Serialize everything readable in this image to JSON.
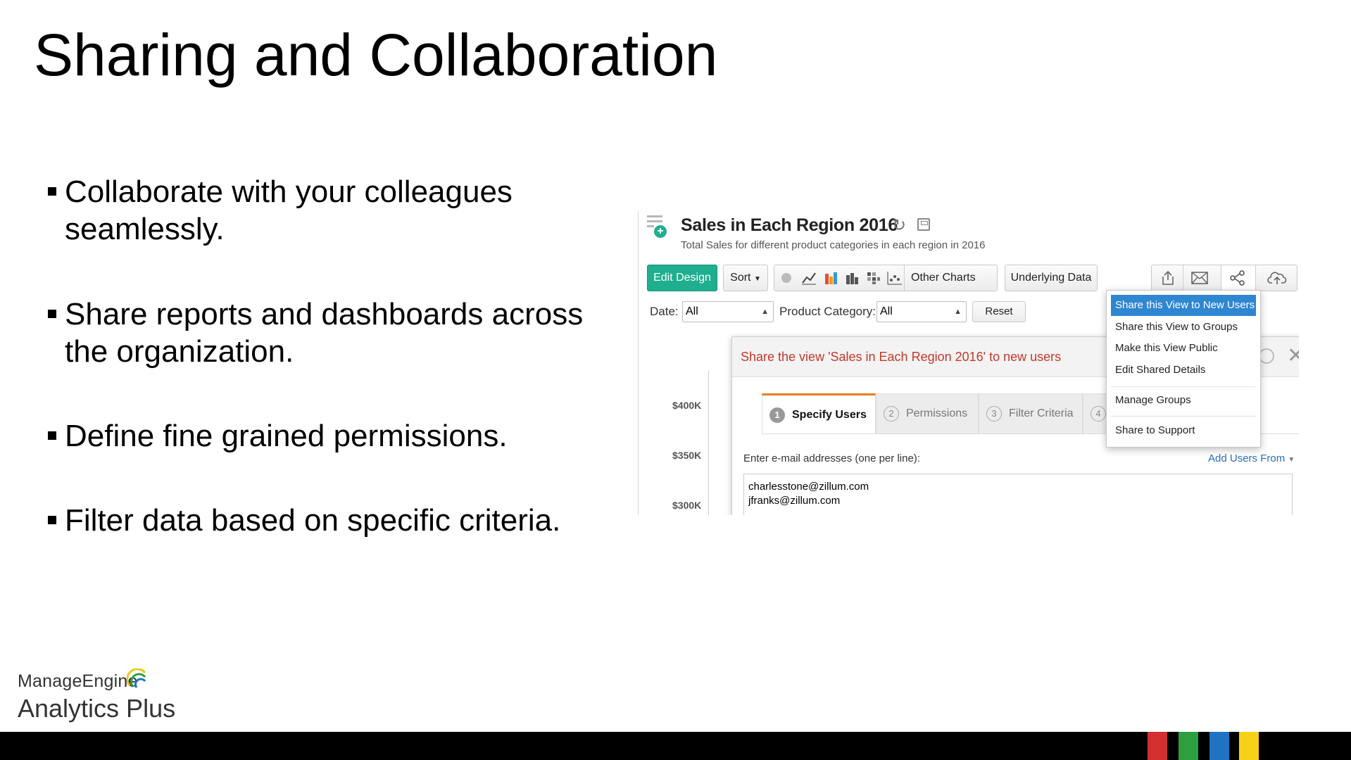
{
  "slide": {
    "title": "Sharing and Collaboration",
    "bullets": [
      "Collaborate with your colleagues seamlessly.",
      "Share reports and dashboards across the organization.",
      "Define fine grained permissions.",
      "Filter data based on specific criteria."
    ]
  },
  "report": {
    "title": "Sales in Each Region 2016",
    "subtitle": "Total Sales for different product categories in each region in 2016",
    "toolbar": {
      "edit_design": "Edit Design",
      "sort": "Sort",
      "other_charts": "Other Charts",
      "underlying_data": "Underlying Data"
    },
    "filters": {
      "date_label": "Date:",
      "date_value": "All",
      "category_label": "Product Category:",
      "category_value": "All",
      "reset": "Reset"
    },
    "y_axis_ticks": [
      "$400K",
      "$350K",
      "$300K"
    ]
  },
  "share_dialog": {
    "title": "Share the view 'Sales in Each Region 2016' to new users",
    "steps": [
      {
        "num": "1",
        "label": "Specify Users"
      },
      {
        "num": "2",
        "label": "Permissions"
      },
      {
        "num": "3",
        "label": "Filter Criteria"
      },
      {
        "num": "4",
        "label": ""
      }
    ],
    "email_label": "Enter e-mail addresses (one per line):",
    "add_users_from": "Add Users From",
    "emails": [
      "charlesstone@zillum.com",
      "jfranks@zillum.com"
    ]
  },
  "share_menu": {
    "items": [
      "Share this View to New Users",
      "Share this View to Groups",
      "Make this View Public",
      "Edit Shared Details",
      "Manage Groups",
      "Share to Support"
    ]
  },
  "branding": {
    "company": "ManageEngine",
    "product": "Analytics Plus",
    "stripe_colors": [
      "#d32f2f",
      "#2e9e3f",
      "#1f73c2",
      "#f7d117"
    ]
  }
}
